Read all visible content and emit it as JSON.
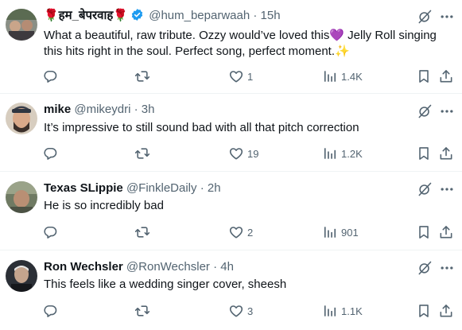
{
  "replies": [
    {
      "name": "🌹हम_बेपरवाह🌹",
      "verified": true,
      "handle": "@hum_beparwaah",
      "separator": "·",
      "time": "15h",
      "text_lines": [
        "What a beautiful, raw tribute. Ozzy would’ve loved this💜 Jelly Roll singing",
        "this hits right in the soul. Perfect song, perfect moment.✨"
      ],
      "replies_count": "",
      "reposts_count": "",
      "likes_count": "1",
      "views_count": "1.4K"
    },
    {
      "name": "mike",
      "verified": false,
      "handle": "@mikeydri",
      "separator": "·",
      "time": "3h",
      "text_lines": [
        "It’s impressive to still sound bad with all that pitch correction"
      ],
      "replies_count": "",
      "reposts_count": "",
      "likes_count": "19",
      "views_count": "1.2K"
    },
    {
      "name": "Texas SLippie",
      "verified": false,
      "handle": "@FinkleDaily",
      "separator": "·",
      "time": "2h",
      "text_lines": [
        "He is so incredibly bad"
      ],
      "replies_count": "",
      "reposts_count": "",
      "likes_count": "2",
      "views_count": "901"
    },
    {
      "name": "Ron Wechsler",
      "verified": false,
      "handle": "@RonWechsler",
      "separator": "·",
      "time": "4h",
      "text_lines": [
        "This feels like a wedding singer cover, sheesh"
      ],
      "replies_count": "",
      "reposts_count": "",
      "likes_count": "3",
      "views_count": "1.1K"
    }
  ],
  "icons": {
    "reply": "reply-icon",
    "repost": "repost-icon",
    "like": "heart-icon",
    "views": "views-chart-icon",
    "bookmark": "bookmark-icon",
    "share": "share-icon",
    "grok": "grok-icon",
    "more": "more-icon",
    "verified": "verified-badge-icon"
  },
  "colors": {
    "text_primary": "#0f1419",
    "text_secondary": "#536471",
    "verified_blue": "#1d9bf0",
    "divider": "#eff3f4"
  }
}
